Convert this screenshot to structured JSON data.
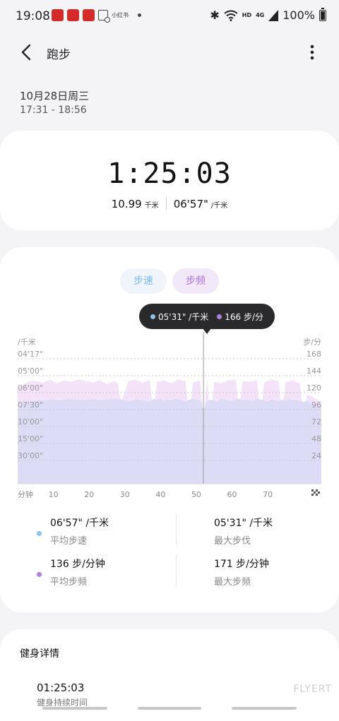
{
  "status": {
    "time": "19:08",
    "apps": [
      "app-icon-1",
      "app-icon-2",
      "app-icon-3"
    ],
    "small_label": "小红书",
    "hd": "HD",
    "net": "4G",
    "battery": "100%"
  },
  "header": {
    "title": "跑步"
  },
  "session": {
    "date": "10月28日周三",
    "time_range": "17:31 - 18:56"
  },
  "summary": {
    "duration": "1:25:03",
    "distance": "10.99",
    "distance_unit": "千米",
    "pace": "06'57\"",
    "pace_unit": "/千米"
  },
  "chart_tabs": {
    "speed": "步速",
    "cadence": "步频"
  },
  "tooltip": {
    "pace": "05'31\" /千米",
    "cadence": "166 步/分"
  },
  "colors": {
    "pace": "#8cc4ee",
    "cadence": "#b080e0",
    "pace_fill": "#dcdcf6",
    "cadence_fill": "#f3e2f8"
  },
  "chart_data": {
    "type": "area",
    "left_axis_label": "/千米",
    "right_axis_label": "步/分",
    "x_label": "分钟",
    "x_ticks": [
      10,
      20,
      30,
      40,
      50,
      60,
      70
    ],
    "left_ticks": [
      "04'17\"",
      "05'00\"",
      "06'00\"",
      "07'30\"",
      "10'00\"",
      "15'00\"",
      "30'00\""
    ],
    "right_ticks": [
      168,
      144,
      120,
      96,
      72,
      48,
      24
    ],
    "xlim": [
      0,
      85
    ],
    "cadence_ylim": [
      0,
      168
    ],
    "cursor_minute": 52,
    "series": [
      {
        "name": "步速",
        "x": [
          0,
          1.5,
          3,
          4,
          6,
          8,
          10,
          12,
          14,
          16,
          18,
          20,
          21.5,
          23,
          25,
          27,
          29,
          30,
          31.5,
          33,
          35,
          37,
          38,
          39,
          40,
          41,
          42,
          43,
          44,
          45,
          46,
          47,
          48,
          49,
          50,
          51,
          52,
          53,
          54,
          55,
          56,
          57,
          58,
          59,
          60,
          61,
          62,
          63,
          64,
          65,
          66,
          67,
          68,
          69,
          70,
          71,
          72,
          73,
          74,
          75,
          76,
          77,
          78,
          79,
          80,
          81,
          82,
          84,
          85
        ],
        "values": [
          100,
          108,
          112,
          111,
          112,
          112,
          113,
          112,
          114,
          113,
          112,
          113,
          114,
          112,
          113,
          114,
          113,
          112,
          111,
          113,
          112,
          110,
          114,
          113,
          114,
          111,
          113,
          112,
          114,
          113,
          112,
          110,
          113,
          114,
          113,
          112,
          100,
          111,
          113,
          112,
          110,
          114,
          113,
          112,
          111,
          113,
          114,
          112,
          113,
          112,
          111,
          114,
          113,
          112,
          110,
          113,
          112,
          111,
          113,
          112,
          114,
          112,
          113,
          111,
          110,
          112,
          108,
          105,
          103
        ]
      },
      {
        "name": "步频",
        "x": [
          0,
          1.5,
          3,
          5,
          7,
          9,
          11,
          13,
          15,
          17,
          19,
          21,
          23,
          25,
          27,
          28,
          29,
          31,
          33,
          35,
          37,
          38,
          39,
          41,
          43,
          45,
          47,
          48,
          49,
          51,
          52,
          53,
          54,
          55,
          57,
          59,
          61,
          62,
          63,
          65,
          67,
          68,
          69,
          71,
          73,
          74,
          75,
          77,
          79,
          80,
          81,
          82,
          84,
          85
        ],
        "values": [
          128,
          133,
          137,
          138,
          136,
          140,
          135,
          139,
          137,
          140,
          138,
          136,
          139,
          134,
          138,
          135,
          109,
          138,
          140,
          136,
          139,
          89,
          137,
          139,
          135,
          140,
          138,
          86,
          136,
          139,
          87,
          138,
          88,
          137,
          135,
          139,
          140,
          99,
          138,
          137,
          139,
          92,
          136,
          140,
          138,
          94,
          137,
          139,
          135,
          89,
          120,
          118,
          113,
          110
        ]
      }
    ]
  },
  "stats": [
    {
      "value": "06'57\" /千米",
      "label": "平均步速",
      "dot": "pace"
    },
    {
      "value": "05'31\" /千米",
      "label": "最大步伐"
    },
    {
      "value": "136 步/分钟",
      "label": "平均步频",
      "dot": "cadence"
    },
    {
      "value": "171 步/分钟",
      "label": "最大步频"
    }
  ],
  "details": {
    "title": "健身详情",
    "duration_value": "01:25:03",
    "duration_label": "健身持续时间"
  },
  "watermark": "FLYERT"
}
